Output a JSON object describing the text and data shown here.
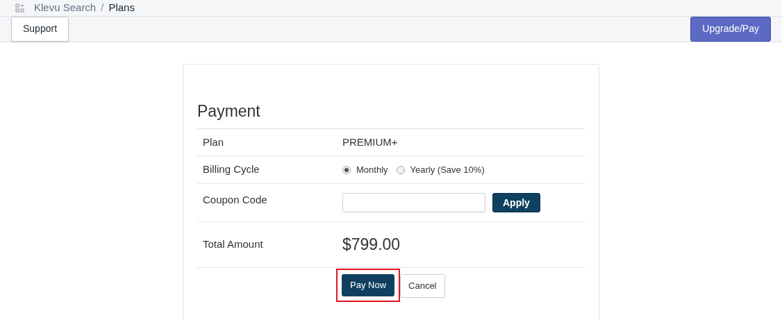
{
  "breadcrumb": {
    "app": "Klevu Search",
    "separator": "/",
    "page": "Plans"
  },
  "toolbar": {
    "support": "Support",
    "upgrade": "Upgrade/Pay"
  },
  "payment": {
    "title": "Payment",
    "plan": {
      "label": "Plan",
      "value": "PREMIUM+"
    },
    "billing": {
      "label": "Billing Cycle",
      "options": [
        {
          "label": "Monthly",
          "selected": true
        },
        {
          "label": "Yearly (Save 10%)",
          "selected": false
        }
      ]
    },
    "coupon": {
      "label": "Coupon Code",
      "apply": "Apply"
    },
    "total": {
      "label": "Total Amount",
      "value": "$799.00"
    },
    "pay_now": {
      "label": "Pay Now",
      "highlighted": true
    },
    "cancel": "Cancel"
  }
}
